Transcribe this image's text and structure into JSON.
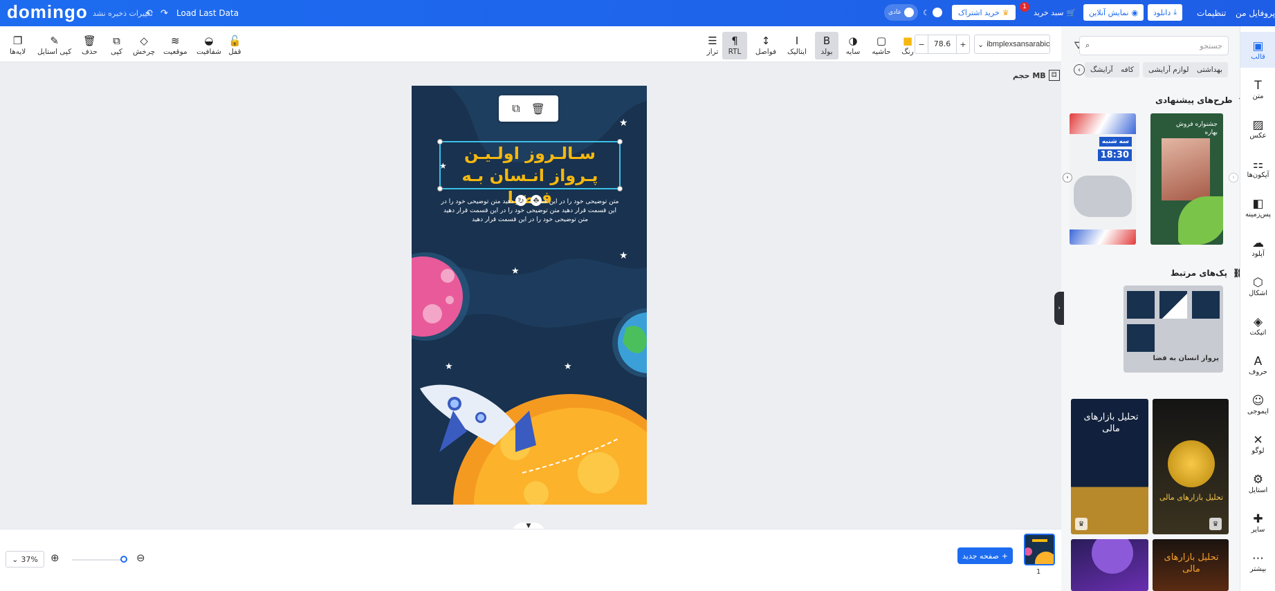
{
  "topbar": {
    "logo": "domingo",
    "unsaved": "تغییرات ذخیره نشد",
    "undo_icon": "undo-icon",
    "redo_icon": "redo-icon",
    "load_last": "Load Last Data",
    "theme_label": "عادی",
    "subscribe": "خرید اشتراک",
    "cart": "سبد خرید",
    "cart_count": "1",
    "preview": "نمایش آنلاین",
    "download": "دانلود",
    "settings": "تنظیمات",
    "profile": "پروفایل من"
  },
  "toolbar": {
    "tools_left": [
      {
        "name": "layers",
        "label": "لایه‌ها",
        "icon": "❐"
      },
      {
        "name": "copy-style",
        "label": "کپی استایل",
        "icon": "✎"
      },
      {
        "name": "delete",
        "label": "حذف",
        "icon": "🗑"
      },
      {
        "name": "copy",
        "label": "کپی",
        "icon": "⧉"
      },
      {
        "name": "rotate",
        "label": "چرخش",
        "icon": "◇"
      },
      {
        "name": "position",
        "label": "موقعیت",
        "icon": "≋"
      },
      {
        "name": "opacity",
        "label": "شفافیت",
        "icon": "◒"
      },
      {
        "name": "lock",
        "label": "قفل",
        "icon": "🔓"
      }
    ],
    "tools_right": [
      {
        "name": "align",
        "label": "تراز",
        "icon": "☰"
      },
      {
        "name": "rtl",
        "label": "RTL",
        "icon": "¶"
      },
      {
        "name": "spacing",
        "label": "فواصل",
        "icon": "↕"
      },
      {
        "name": "italic",
        "label": "ایتالیک",
        "icon": "I"
      },
      {
        "name": "bold",
        "label": "بولد",
        "icon": "B"
      },
      {
        "name": "shadow",
        "label": "سایه",
        "icon": "◑"
      },
      {
        "name": "border",
        "label": "حاشیه",
        "icon": "▢"
      },
      {
        "name": "color",
        "label": "رنگ",
        "icon": "■"
      }
    ],
    "font_size": "78.6",
    "font_name": "ibmplexsansarabic",
    "color_value": "#f5b80f"
  },
  "canvas": {
    "size_label": "حجم MB",
    "title_line1": "سـالـروز اولـیـن",
    "title_line2": "پـرواز انـسان بـه فـضـا",
    "body_text": "متن توضیحی خود را در این قسمت قرار دهید متن توضیحی خود را در این قسمت قرار دهید متن توضیحی خود را در این قسمت قرار دهید متن توضیحی خود را در این قسمت قرار دهید"
  },
  "bottom": {
    "zoom": "37%",
    "new_page": "صفحه جدید",
    "page_number": "1"
  },
  "sidebar": {
    "search_placeholder": "جستجو",
    "chips": [
      "بهداشتی",
      "لوازم آرایشی",
      "کافه",
      "آرایشگ"
    ],
    "suggested_title": "طرح‌های پیشنهادی",
    "packs_title": "پک‌های مرتبط",
    "pack_name": "پرواز انسان به فضا",
    "thumb1_text": "سه شنبه",
    "thumb1_time": "18:30",
    "thumb2_text": "جشنواره فروش بهاره",
    "card1_title": "تحلیل بازارهای مالی",
    "card2_title": "تحلیل بازارهای مالی",
    "card3_title": "تحلیل بازارهای مالی"
  },
  "rightnav": [
    {
      "name": "template",
      "label": "قالب",
      "icon": "▣"
    },
    {
      "name": "text",
      "label": "متن",
      "icon": "T"
    },
    {
      "name": "photo",
      "label": "عکس",
      "icon": "▨"
    },
    {
      "name": "icons",
      "label": "آیکون‌ها",
      "icon": "⚏"
    },
    {
      "name": "background",
      "label": "پس‌زمینه",
      "icon": "◧"
    },
    {
      "name": "upload",
      "label": "آپلود",
      "icon": "☁"
    },
    {
      "name": "shapes",
      "label": "اشکال",
      "icon": "⬡"
    },
    {
      "name": "sticker",
      "label": "اتیکت",
      "icon": "◈"
    },
    {
      "name": "fonts",
      "label": "حروف",
      "icon": "A"
    },
    {
      "name": "emoji",
      "label": "ایموجی",
      "icon": "☺"
    },
    {
      "name": "logo",
      "label": "لوگو",
      "icon": "✕"
    },
    {
      "name": "style",
      "label": "استایل",
      "icon": "⚙"
    },
    {
      "name": "other",
      "label": "سایر",
      "icon": "✚"
    },
    {
      "name": "more",
      "label": "بیشتر",
      "icon": "⋯"
    }
  ]
}
